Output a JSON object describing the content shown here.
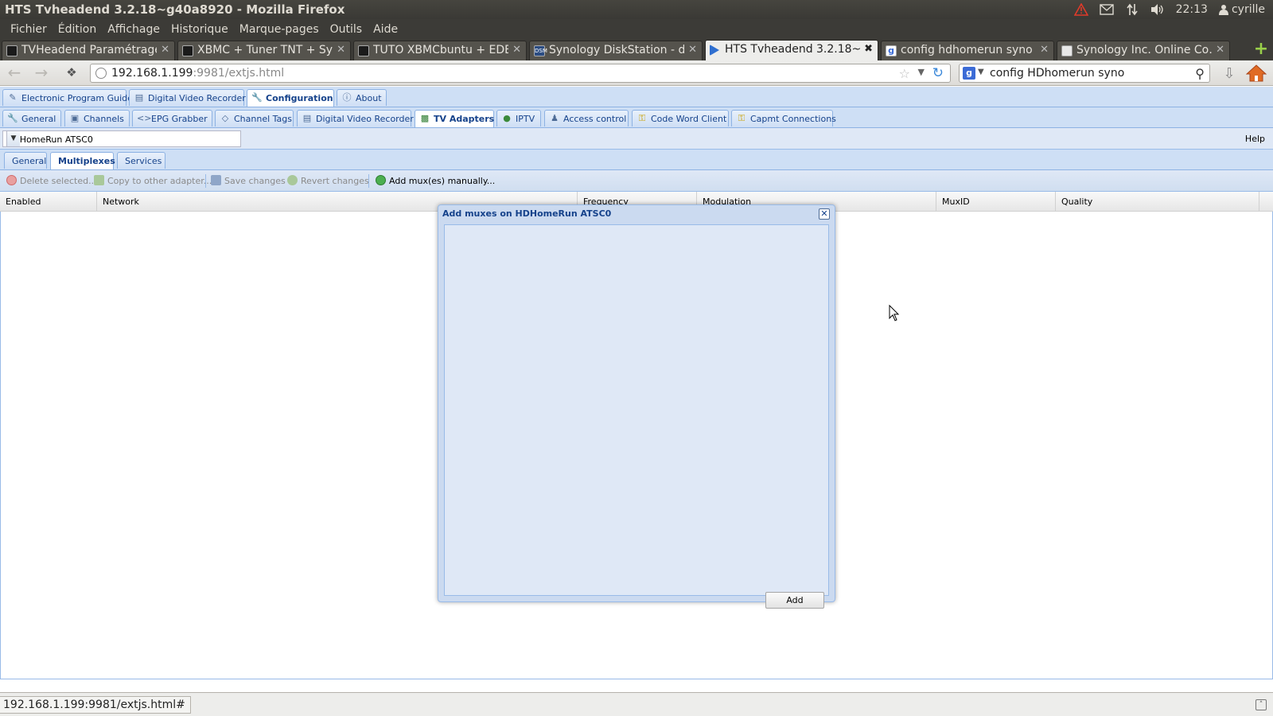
{
  "panel": {
    "window_title": "HTS Tvheadend 3.2.18~g40a8920 - Mozilla Firefox",
    "clock": "22:13",
    "user": "cyrille"
  },
  "menu": [
    "Fichier",
    "Édition",
    "Affichage",
    "Historique",
    "Marque-pages",
    "Outils",
    "Aide"
  ],
  "browser_tabs": [
    {
      "label": "TVHeadend Paramétrage",
      "icon": "page-icon"
    },
    {
      "label": "XBMC + Tuner TNT + Syn…",
      "icon": "page-icon"
    },
    {
      "label": "TUTO XBMCbuntu + EDE…",
      "icon": "page-icon"
    },
    {
      "label": "Synology DiskStation - d…",
      "icon": "dsm-icon"
    },
    {
      "label": "HTS Tvheadend 3.2.18~…",
      "icon": "tvheadend-icon"
    },
    {
      "label": "config hdhomerun syno …",
      "icon": "google-icon"
    },
    {
      "label": "Synology Inc. Online Co…",
      "icon": "synology-icon"
    }
  ],
  "nav": {
    "url_host": "192.168.1.199",
    "url_rest": ":9981/extjs.html",
    "search_value": "config HDhomerun syno"
  },
  "app": {
    "top_tabs": [
      {
        "label": "Electronic Program Guide",
        "icon": "epg-icon"
      },
      {
        "label": "Digital Video Recorder",
        "icon": "dvr-icon"
      },
      {
        "label": "Configuration",
        "icon": "wrench-icon"
      },
      {
        "label": "About",
        "icon": "info-icon"
      }
    ],
    "config_tabs": [
      {
        "label": "General",
        "icon": "wrench-icon"
      },
      {
        "label": "Channels",
        "icon": "tv-icon"
      },
      {
        "label": "EPG Grabber",
        "icon": "code-icon"
      },
      {
        "label": "Channel Tags",
        "icon": "tag-icon"
      },
      {
        "label": "Digital Video Recorder",
        "icon": "dvr-icon"
      },
      {
        "label": "TV Adapters",
        "icon": "card-icon"
      },
      {
        "label": "IPTV",
        "icon": "globe-icon"
      },
      {
        "label": "Access control",
        "icon": "users-icon"
      },
      {
        "label": "Code Word Client",
        "icon": "key-icon"
      },
      {
        "label": "Capmt Connections",
        "icon": "key-icon"
      }
    ],
    "adapter_select": "HDHomeRun ATSC0",
    "help": "Help",
    "inner_tabs": [
      "General",
      "Multiplexes",
      "Services"
    ],
    "toolbar": {
      "delete": "Delete selected...",
      "copy": "Copy to other adapter...",
      "save": "Save changes",
      "revert": "Revert changes",
      "add": "Add mux(es) manually..."
    },
    "grid_columns": [
      "Enabled",
      "Network",
      "Frequency",
      "Modulation",
      "MuxID",
      "Quality"
    ]
  },
  "dialog": {
    "title": "Add muxes on HDHomeRun ATSC0",
    "add_button": "Add"
  },
  "status": {
    "link": "192.168.1.199:9981/extjs.html#"
  },
  "colors": {
    "ext_header": "#15428b",
    "ext_bg": "#dfe8f6",
    "ext_border": "#99bbe8",
    "ubuntu_panel": "#3c3b37"
  }
}
